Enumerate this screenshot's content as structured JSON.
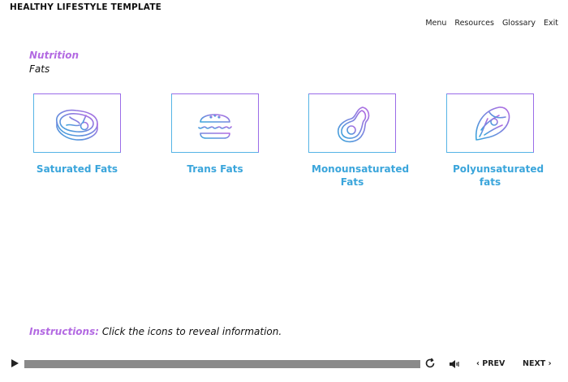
{
  "app": {
    "title": "HEALTHY LIFESTYLE TEMPLATE"
  },
  "nav": {
    "menu": "Menu",
    "resources": "Resources",
    "glossary": "Glossary",
    "exit": "Exit"
  },
  "content": {
    "section": "Nutrition",
    "subsection": "Fats",
    "cards": [
      {
        "icon": "steak-icon",
        "label": "Saturated Fats"
      },
      {
        "icon": "burger-icon",
        "label": "Trans Fats"
      },
      {
        "icon": "avocado-icon",
        "label": "Monounsaturated Fats"
      },
      {
        "icon": "salmon-icon",
        "label": "Polyunsaturated fats"
      }
    ]
  },
  "instructions": {
    "label": "Instructions:",
    "text": " Click the icons to reveal information."
  },
  "player": {
    "prev": "PREV",
    "next": "NEXT",
    "progress": 0
  },
  "colors": {
    "accent_purple": "#b36ae2",
    "accent_blue": "#3aa5db"
  }
}
